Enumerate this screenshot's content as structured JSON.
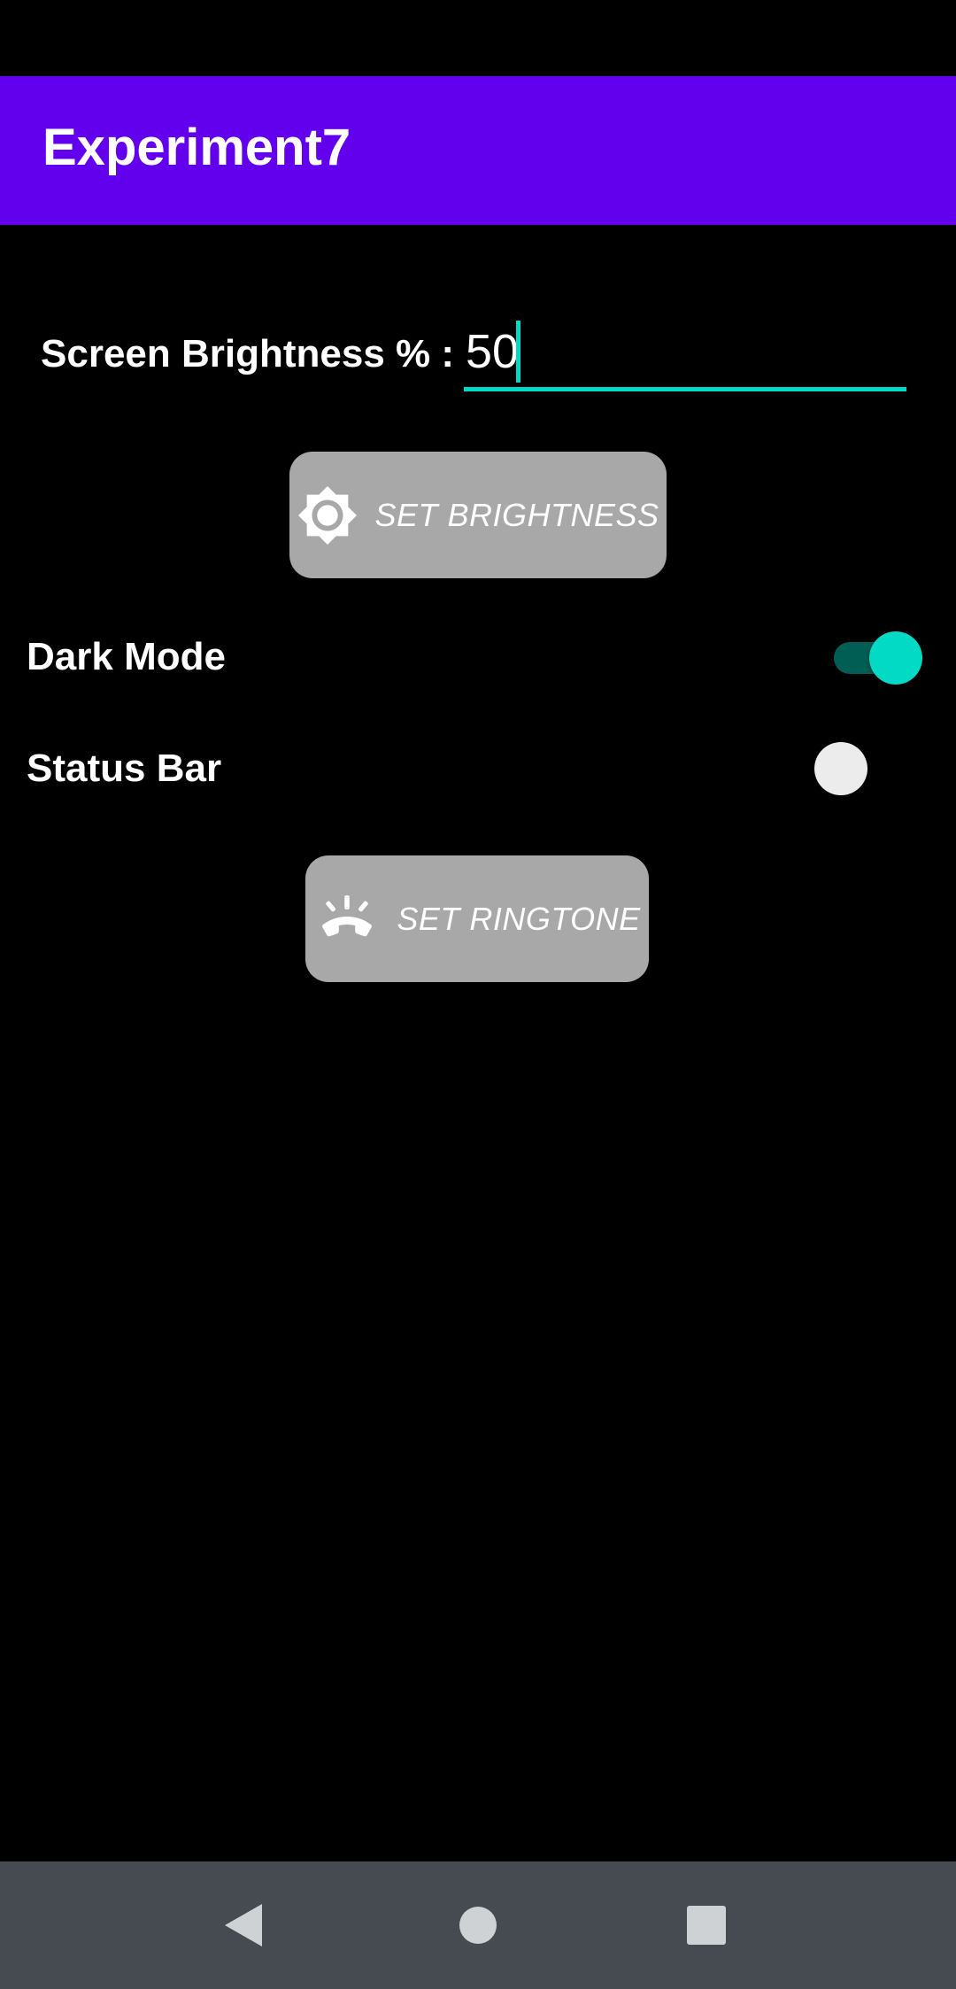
{
  "app": {
    "title": "Experiment7"
  },
  "brightness": {
    "label": "Screen Brightness % :",
    "value": "50",
    "button_label": "SET BRIGHTNESS",
    "button_icon": "brightness-icon"
  },
  "dark_mode": {
    "label": "Dark Mode",
    "checked": true
  },
  "status_bar": {
    "label": "Status Bar",
    "checked": false
  },
  "ringtone": {
    "button_label": "SET RINGTONE",
    "button_icon": "ringing-phone-icon"
  },
  "navigation": {
    "icons": [
      "back-icon",
      "home-icon",
      "recents-icon"
    ]
  },
  "colors": {
    "primary": "#6200ee",
    "accent": "#03dac5",
    "button": "#a8a8a8",
    "nav_bar": "#454b50",
    "background": "#000000"
  }
}
